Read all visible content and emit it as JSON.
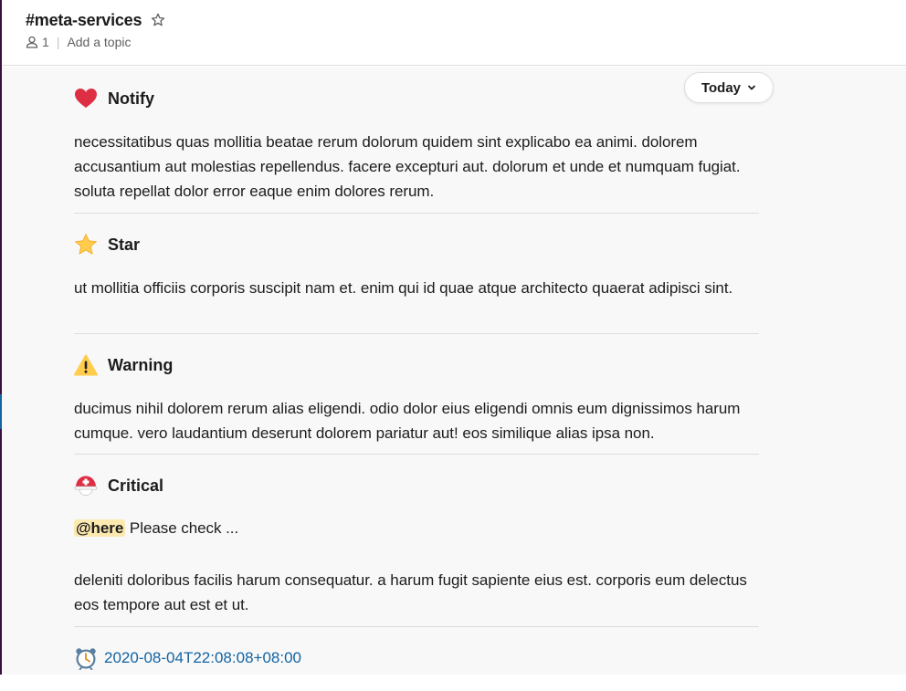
{
  "channel": {
    "name": "#meta-services",
    "member_count": "1",
    "topic_placeholder": "Add a topic"
  },
  "date_divider": {
    "label": "Today"
  },
  "messages": [
    {
      "icon": "red-heart-emoji",
      "title": "Notify",
      "body": "necessitatibus quas mollitia beatae rerum dolorum quidem sint explicabo ea animi. dolorem accusantium aut molestias repellendus. facere excepturi aut. dolorum et unde et numquam fugiat. soluta repellat dolor error eaque enim dolores rerum."
    },
    {
      "icon": "star-emoji",
      "title": "Star",
      "body": "ut mollitia officiis corporis suscipit nam et. enim qui id quae atque architecto quaerat adipisci sint."
    },
    {
      "icon": "warning-emoji",
      "title": "Warning",
      "body": "ducimus nihil dolorem rerum alias eligendi. odio dolor eius eligendi omnis eum dignissimos harum cumque. vero laudantium deserunt dolorem pariatur aut! eos similique alias ipsa non."
    },
    {
      "icon": "rescue-helmet-emoji",
      "title": "Critical",
      "mention": "@here",
      "mention_text": " Please check ...",
      "body": "deleniti doloribus facilis harum consequatur. a harum fugit sapiente eius est. corporis eum delectus eos tempore aut est et ut."
    }
  ],
  "timestamp": {
    "icon": "alarm-clock-emoji",
    "text": "2020-08-04T22:08:08+08:00"
  },
  "colors": {
    "sidebar_edge": "#3f0e40",
    "link": "#1264a3",
    "mention_bg": "#fce9b0",
    "heart_red": "#dd2e44",
    "star_yellow": "#ffcc4d",
    "warning_yellow": "#ffcc4d"
  }
}
